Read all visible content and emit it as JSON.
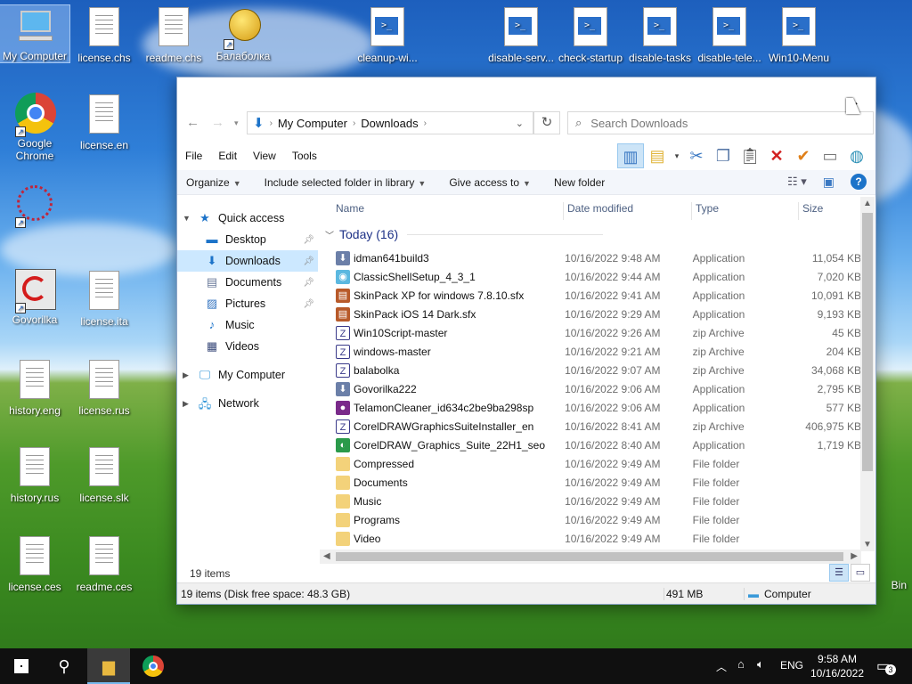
{
  "desktop": {
    "icons": [
      {
        "label": "My Computer"
      },
      {
        "label": "license.chs"
      },
      {
        "label": "readme.chs"
      },
      {
        "label": "Балаболка"
      },
      {
        "label": "cleanup-wi..."
      },
      {
        "label": "disable-serv..."
      },
      {
        "label": "check-startup"
      },
      {
        "label": "disable-tasks"
      },
      {
        "label": "disable-tele..."
      },
      {
        "label": "Win10-Menu"
      },
      {
        "label": "Google Chrome"
      },
      {
        "label": "license.en"
      },
      {
        "label": "Govorilka"
      },
      {
        "label": "license.ita"
      },
      {
        "label": "history.eng"
      },
      {
        "label": "license.rus"
      },
      {
        "label": "history.rus"
      },
      {
        "label": "license.slk"
      },
      {
        "label": "license.ces"
      },
      {
        "label": "readme.ces"
      },
      {
        "label": "Bin"
      }
    ]
  },
  "window": {
    "address": {
      "segments": [
        "My Computer",
        "Downloads"
      ]
    },
    "search_placeholder": "Search Downloads",
    "menu": [
      "File",
      "Edit",
      "View",
      "Tools"
    ],
    "commands": {
      "organize": "Organize",
      "include": "Include selected folder in library",
      "give_access": "Give access to",
      "new_folder": "New folder"
    },
    "nav": {
      "quick_access": "Quick access",
      "items": [
        "Desktop",
        "Downloads",
        "Documents",
        "Pictures",
        "Music",
        "Videos"
      ],
      "my_computer": "My Computer",
      "network": "Network"
    },
    "columns": {
      "name": "Name",
      "date": "Date modified",
      "type": "Type",
      "size": "Size"
    },
    "group_label": "Today (16)",
    "files": [
      {
        "name": "idman641build3",
        "date": "10/16/2022 9:48 AM",
        "type": "Application",
        "size": "11,054 KB",
        "icon": "installer-icon"
      },
      {
        "name": "ClassicShellSetup_4_3_1",
        "date": "10/16/2022 9:44 AM",
        "type": "Application",
        "size": "7,020 KB",
        "icon": "shell-icon"
      },
      {
        "name": "SkinPack XP for windows 7.8.10.sfx",
        "date": "10/16/2022 9:41 AM",
        "type": "Application",
        "size": "10,091 KB",
        "icon": "archive-app-icon"
      },
      {
        "name": "SkinPack iOS 14 Dark.sfx",
        "date": "10/16/2022 9:29 AM",
        "type": "Application",
        "size": "9,193 KB",
        "icon": "archive-app-icon"
      },
      {
        "name": "Win10Script-master",
        "date": "10/16/2022 9:26 AM",
        "type": "zip Archive",
        "size": "45 KB",
        "icon": "zip-icon"
      },
      {
        "name": "windows-master",
        "date": "10/16/2022 9:21 AM",
        "type": "zip Archive",
        "size": "204 KB",
        "icon": "zip-icon"
      },
      {
        "name": "balabolka",
        "date": "10/16/2022 9:07 AM",
        "type": "zip Archive",
        "size": "34,068 KB",
        "icon": "zip-icon"
      },
      {
        "name": "Govorilka222",
        "date": "10/16/2022 9:06 AM",
        "type": "Application",
        "size": "2,795 KB",
        "icon": "installer-icon"
      },
      {
        "name": "TelamonCleaner_id634c2be9ba298sp",
        "date": "10/16/2022 9:06 AM",
        "type": "Application",
        "size": "577 KB",
        "icon": "cleaner-icon"
      },
      {
        "name": "CorelDRAWGraphicsSuiteInstaller_en",
        "date": "10/16/2022 8:41 AM",
        "type": "zip Archive",
        "size": "406,975 KB",
        "icon": "zip-icon"
      },
      {
        "name": "CorelDRAW_Graphics_Suite_22H1_seo",
        "date": "10/16/2022 8:40 AM",
        "type": "Application",
        "size": "1,719 KB",
        "icon": "corel-icon"
      },
      {
        "name": "Compressed",
        "date": "10/16/2022 9:49 AM",
        "type": "File folder",
        "size": "",
        "icon": "folder-icon"
      },
      {
        "name": "Documents",
        "date": "10/16/2022 9:49 AM",
        "type": "File folder",
        "size": "",
        "icon": "folder-icon"
      },
      {
        "name": "Music",
        "date": "10/16/2022 9:49 AM",
        "type": "File folder",
        "size": "",
        "icon": "folder-icon"
      },
      {
        "name": "Programs",
        "date": "10/16/2022 9:49 AM",
        "type": "File folder",
        "size": "",
        "icon": "folder-icon"
      },
      {
        "name": "Video",
        "date": "10/16/2022 9:49 AM",
        "type": "File folder",
        "size": "",
        "icon": "folder-icon"
      }
    ],
    "item_count": "19 items",
    "status": {
      "left": "19 items (Disk free space: 48.3 GB)",
      "size": "491 MB",
      "location": "Computer"
    }
  },
  "taskbar": {
    "language": "ENG",
    "time": "9:58 AM",
    "date": "10/16/2022",
    "notifications": "3"
  }
}
